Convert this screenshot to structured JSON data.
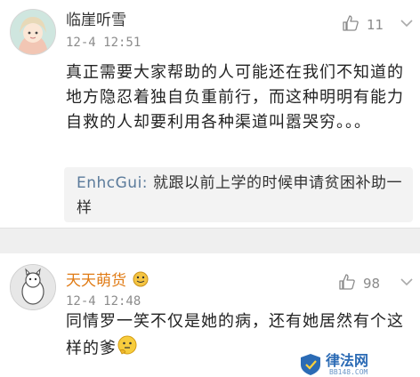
{
  "comments": [
    {
      "username": "临崖听雪",
      "timestamp": "12-4 12:51",
      "likes": "11",
      "text": "真正需要大家帮助的人可能还在我们不知道的地方隐忍着独自负重前行，而这种明明有能力自救的人却要利用各种渠道叫嚣哭穷。。。",
      "reply": {
        "author": "EnhcGui:",
        "text": "就跟以前上学的时候申请贫困补助一样"
      },
      "icons": {
        "like": "thumbs-up-icon",
        "more": "chevron-down-icon",
        "avatar": "avatar-girl"
      }
    },
    {
      "username": "天天萌货",
      "timestamp": "12-4 12:48",
      "likes": "98",
      "text": "同情罗一笑不仅是她的病，还有她居然有个这样的爹",
      "icons": {
        "like": "thumbs-up-icon",
        "more": "chevron-down-icon",
        "avatar": "avatar-sketch-cat",
        "badge": "vip-emoji-icon",
        "emoji": "thinking-face-emoji"
      }
    }
  ],
  "watermark": {
    "name": "律法网",
    "url": "BB148.COM",
    "color": "#2b6bb5"
  },
  "colors": {
    "username_highlight": "#e07b15",
    "reply_author": "#5b7b9b",
    "separator": "#efefef"
  }
}
